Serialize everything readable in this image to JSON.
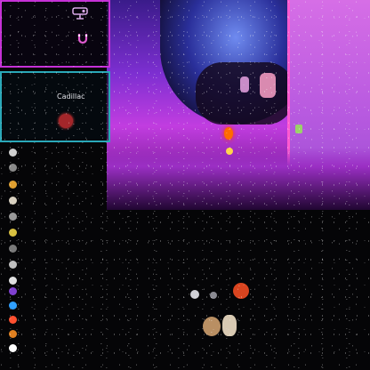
{
  "overlay_panel_top": {
    "lines": [
      "",
      "",
      "",
      ""
    ]
  },
  "overlay_panel_middle": {
    "caption": "Cadillac",
    "lines": [
      "",
      "",
      "",
      "",
      ""
    ]
  },
  "chat": {
    "rows": [
      {
        "name": "",
        "color": "#cfcfcf"
      },
      {
        "name": "",
        "color": "#8a8a8a"
      },
      {
        "name": "",
        "color": "#e0a030"
      },
      {
        "name": "",
        "color": "#d8d0c0"
      },
      {
        "name": "",
        "color": "#9a9a9a"
      },
      {
        "name": "",
        "color": "#d8c040"
      },
      {
        "name": "",
        "color": "#7a7a7a"
      },
      {
        "name": "",
        "color": "#c0c0c0"
      },
      {
        "name": "",
        "color": "#e0e0e0"
      },
      {
        "name": "",
        "color": "#8040d0"
      },
      {
        "name": "",
        "color": "#30a0ff"
      },
      {
        "name": "",
        "color": "#ff5030"
      },
      {
        "name": "",
        "color": "#e08020"
      },
      {
        "name": "",
        "color": "#ffffff"
      }
    ]
  },
  "footer": {
    "text": "",
    "right": ""
  },
  "colors": {
    "panel_top_border": "#c531d6",
    "panel_middle_border": "#2aa8b8",
    "stream_accent": "#c13de0"
  }
}
